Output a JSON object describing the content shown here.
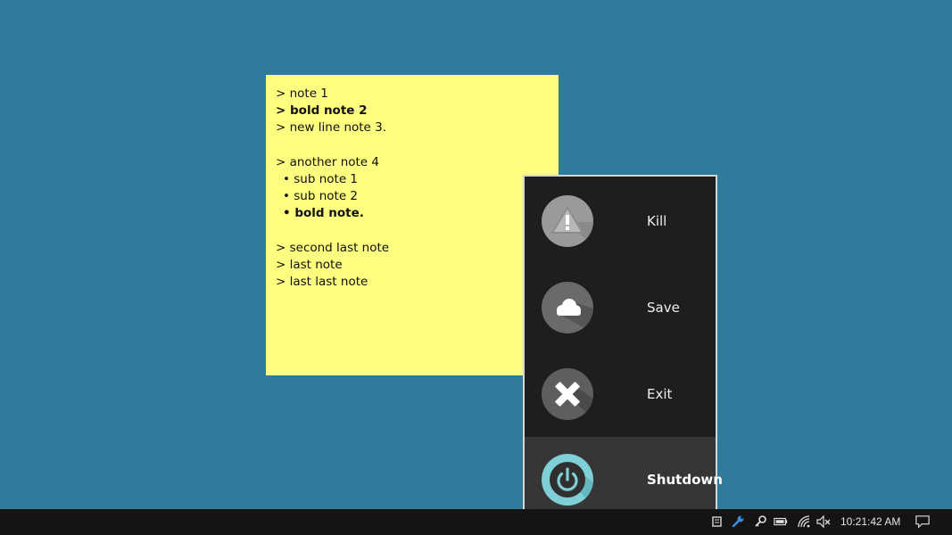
{
  "note": {
    "lines": [
      "> note 1",
      "> bold note 2",
      "> new line note 3.",
      "",
      "> another note 4",
      "• sub note 1",
      "• sub note 2",
      "• bold note.",
      "",
      "> second last note",
      "> last note",
      "> last last note"
    ]
  },
  "menu": {
    "items": [
      {
        "label": "Kill",
        "icon": "warning-icon"
      },
      {
        "label": "Save",
        "icon": "cloud-icon"
      },
      {
        "label": "Exit",
        "icon": "x-icon"
      },
      {
        "label": "Shutdown",
        "icon": "power-icon"
      }
    ]
  },
  "taskbar": {
    "clock": "10:21:42 AM",
    "tray_icons": [
      "notes-icon",
      "wrench-icon",
      "key-icon",
      "battery-icon",
      "wifi-icon",
      "volume-muted-icon",
      "action-center-icon"
    ]
  },
  "colors": {
    "desktop": "#2e7b9b",
    "note": "#fdfd80",
    "menu_bg": "#1e1e1e",
    "menu_active": "#363636",
    "power_accent": "#7ecfd6"
  }
}
